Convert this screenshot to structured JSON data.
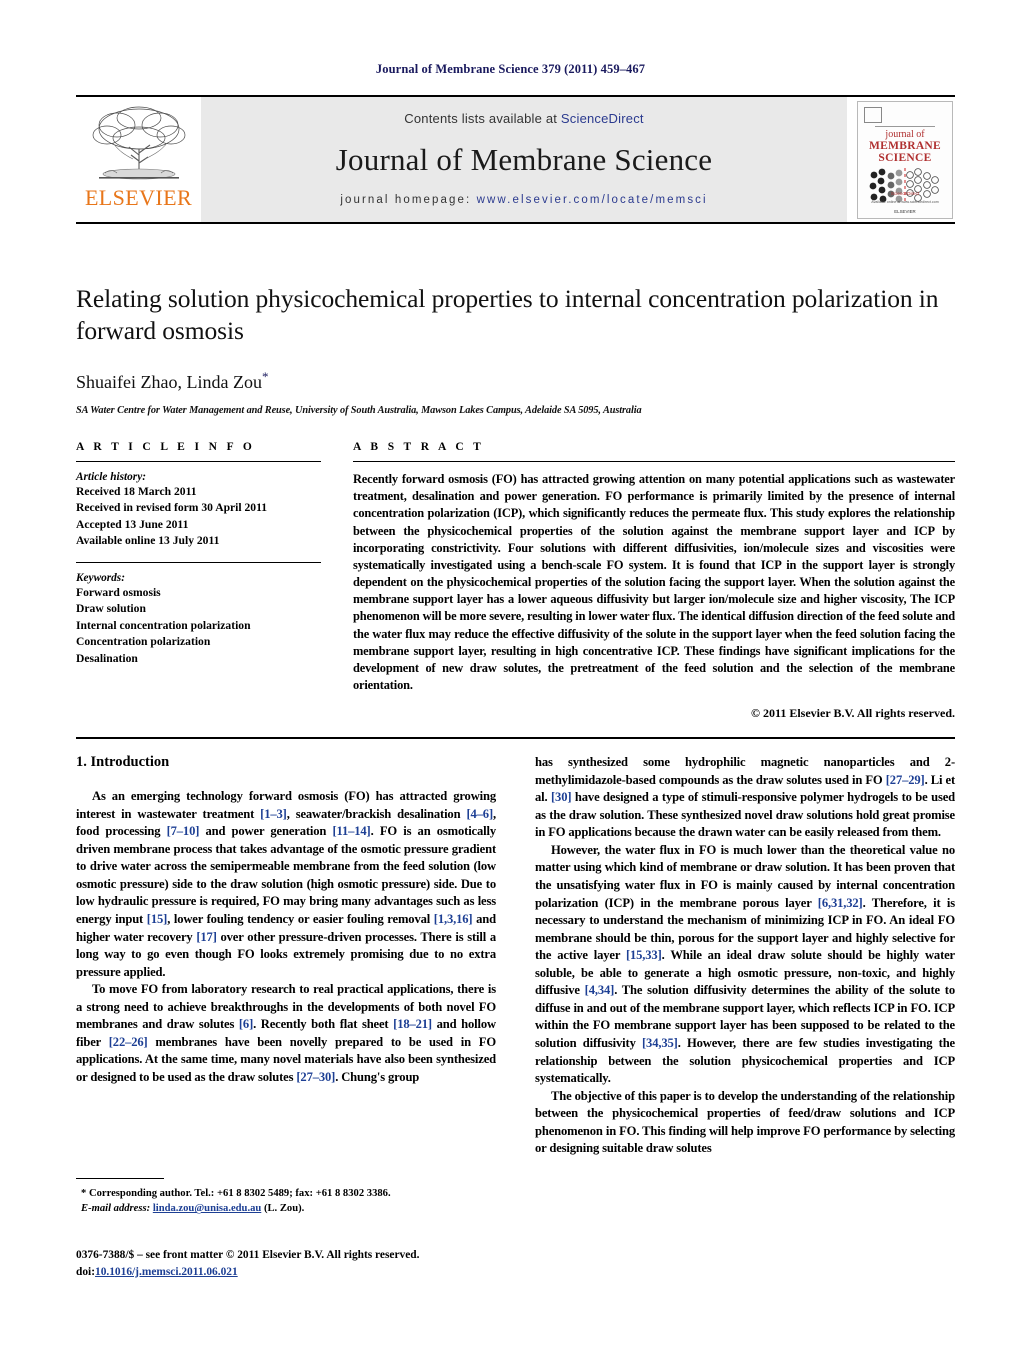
{
  "running_head": "Journal of Membrane Science 379 (2011) 459–467",
  "masthead": {
    "contents_prefix": "Contents lists available at ",
    "sciencedirect": "ScienceDirect",
    "journal_title": "Journal of Membrane Science",
    "homepage_prefix": "journal homepage:",
    "homepage_url": "www.elsevier.com/locate/memsci",
    "publisher": "ELSEVIER",
    "cover": {
      "line1": "journal of",
      "line2": "MEMBRANE",
      "line3": "SCIENCE",
      "sd_note": "ScienceDirect",
      "foot1": "Available online at www.sciencedirect.com",
      "foot2": "ELSEVIER"
    }
  },
  "article": {
    "title": "Relating solution physicochemical properties to internal concentration polarization in forward osmosis",
    "authors": "Shuaifei Zhao, Linda Zou",
    "corresponding_mark": "*",
    "affiliation": "SA Water Centre for Water Management and Reuse, University of South Australia, Mawson Lakes Campus, Adelaide SA 5095, Australia"
  },
  "info": {
    "heading": "A R T I C L E    I N F O",
    "history_label": "Article history:",
    "history": [
      "Received 18 March 2011",
      "Received in revised form 30 April 2011",
      "Accepted 13 June 2011",
      "Available online 13 July 2011"
    ],
    "keywords_label": "Keywords:",
    "keywords": [
      "Forward osmosis",
      "Draw solution",
      "Internal concentration polarization",
      "Concentration polarization",
      "Desalination"
    ]
  },
  "abstract": {
    "heading": "A B S T R A C T",
    "text": "Recently forward osmosis (FO) has attracted growing attention on many potential applications such as wastewater treatment, desalination and power generation. FO performance is primarily limited by the presence of internal concentration polarization (ICP), which significantly reduces the permeate flux. This study explores the relationship between the physicochemical properties of the solution against the membrane support layer and ICP by incorporating constrictivity. Four solutions with different diffusivities, ion/molecule sizes and viscosities were systematically investigated using a bench-scale FO system. It is found that ICP in the support layer is strongly dependent on the physicochemical properties of the solution facing the support layer. When the solution against the membrane support layer has a lower aqueous diffusivity but larger ion/molecule size and higher viscosity, The ICP phenomenon will be more severe, resulting in lower water flux. The identical diffusion direction of the feed solute and the water flux may reduce the effective diffusivity of the solute in the support layer when the feed solution facing the membrane support layer, resulting in high concentrative ICP. These findings have significant implications for the development of new draw solutes, the pretreatment of the feed solution and the selection of the membrane orientation.",
    "copyright": "© 2011 Elsevier B.V. All rights reserved."
  },
  "introduction": {
    "heading": "1.  Introduction",
    "left_paragraphs": [
      "As an emerging technology forward osmosis (FO) has attracted growing interest in wastewater treatment [1–3], seawater/brackish desalination [4–6], food processing [7–10] and power generation [11–14]. FO is an osmotically driven membrane process that takes advantage of the osmotic pressure gradient to drive water across the semipermeable membrane from the feed solution (low osmotic pressure) side to the draw solution (high osmotic pressure) side. Due to low hydraulic pressure is required, FO may bring many advantages such as less energy input [15], lower fouling tendency or easier fouling removal [1,3,16] and higher water recovery [17] over other pressure-driven processes. There is still a long way to go even though FO looks extremely promising due to no extra pressure applied.",
      "To move FO from laboratory research to real practical applications, there is a strong need to achieve breakthroughs in the developments of both novel FO membranes and draw solutes [6]. Recently both flat sheet [18–21] and hollow fiber [22–26] membranes have been novelly prepared to be used in FO applications. At the same time, many novel materials have also been synthesized or designed to be used as the draw solutes [27–30]. Chung's group"
    ],
    "right_paragraphs": [
      "has synthesized some hydrophilic magnetic nanoparticles and 2-methylimidazole-based compounds as the draw solutes used in FO [27–29]. Li et al. [30] have designed a type of stimuli-responsive polymer hydrogels to be used as the draw solution. These synthesized novel draw solutions hold great promise in FO applications because the drawn water can be easily released from them.",
      "However, the water flux in FO is much lower than the theoretical value no matter using which kind of membrane or draw solution. It has been proven that the unsatisfying water flux in FO is mainly caused by internal concentration polarization (ICP) in the membrane porous layer [6,31,32]. Therefore, it is necessary to understand the mechanism of minimizing ICP in FO. An ideal FO membrane should be thin, porous for the support layer and highly selective for the active layer [15,33]. While an ideal draw solute should be highly water soluble, be able to generate a high osmotic pressure, non-toxic, and highly diffusive [4,34]. The solution diffusivity determines the ability of the solute to diffuse in and out of the membrane support layer, which reflects ICP in FO. ICP within the FO membrane support layer has been supposed to be related to the solution diffusivity [34,35]. However, there are few studies investigating the relationship between the solution physicochemical properties and ICP systematically.",
      "The objective of this paper is to develop the understanding of the relationship between the physicochemical properties of feed/draw solutions and ICP phenomenon in FO. This finding will help improve FO performance by selecting or designing suitable draw solutes"
    ]
  },
  "footnote": {
    "corresponding": "* Corresponding author. Tel.: +61 8 8302 5489; fax: +61 8 8302 3386.",
    "email_label": "E-mail address:",
    "email": "linda.zou@unisa.edu.au",
    "email_suffix": "(L. Zou).",
    "issn_line": "0376-7388/$ – see front matter © 2011 Elsevier B.V. All rights reserved.",
    "doi_label": "doi:",
    "doi": "10.1016/j.memsci.2011.06.021"
  },
  "colors": {
    "link": "#1d3f94",
    "running_head": "#1a1a5e",
    "elsevier_orange": "#e8761a",
    "cover_red": "#b03030",
    "masthead_bg": "#e9e9e9"
  }
}
